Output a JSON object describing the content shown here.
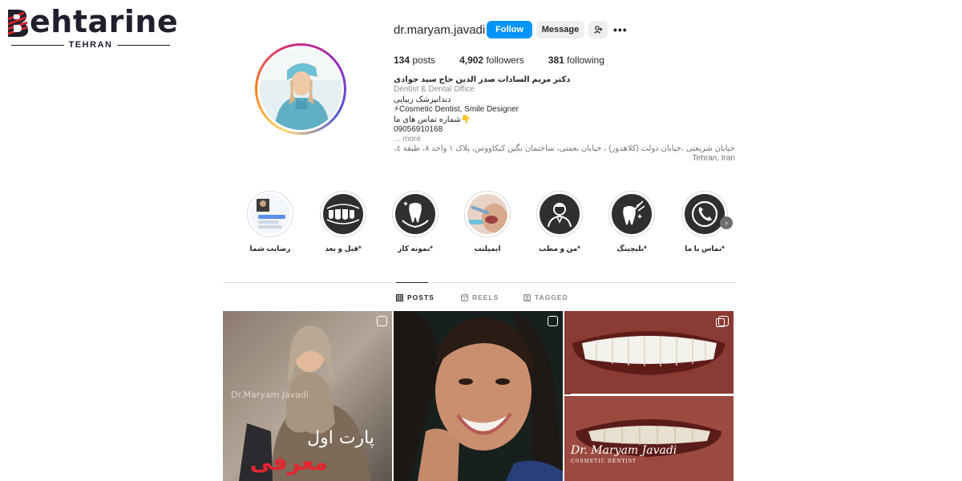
{
  "watermark": {
    "brand": "ehtarine",
    "brand_initial": "B",
    "city": "TEHRAN"
  },
  "profile": {
    "username": "dr.maryam.javadi",
    "follow_label": "Follow",
    "message_label": "Message",
    "add_user_icon": "person-add-icon",
    "more_icon": "more-options-icon",
    "more_glyph": "•••",
    "stats": {
      "posts_count": "134",
      "posts_label": "posts",
      "followers_count": "4,902",
      "followers_label": "followers",
      "following_count": "381",
      "following_label": "following"
    }
  },
  "bio": {
    "name": "دکتر مریم السادات صدر الدین حاج سید جوادی",
    "category": "Dentist & Dental Office",
    "line1": "دندانپزشک زیبایی",
    "line2": "⚡Cosmetic Dentist, Smile Designer",
    "line3": "👇شماره تماس های ما",
    "phone": "09056910168",
    "more": "... more",
    "address": "خیابان شریعتی ،خیابان دولت (کلاهدوز) ، خیابان نعمتی، ساختمان نگین کیکاووس، پلاک ۱ واحد ۸، طبقه ٤،",
    "city": "Tehran, Iran"
  },
  "highlights": [
    {
      "label": "رضایت شما",
      "icon": "chat-screenshot-thumb"
    },
    {
      "label": "*قبل و بعد",
      "icon": "teeth-row-icon"
    },
    {
      "label": "*نمونه کار",
      "icon": "tooth-hands-icon"
    },
    {
      "label": "ایمپلنت",
      "icon": "dental-procedure-photo"
    },
    {
      "label": "*من و مطب",
      "icon": "doctor-icon"
    },
    {
      "label": "*بلیچینگ",
      "icon": "tooth-bleaching-icon"
    },
    {
      "label": "*تماس با ما",
      "icon": "phone-icon"
    }
  ],
  "highlights_next": "›",
  "tabs": [
    {
      "label": "POSTS",
      "icon": "grid-icon",
      "active": true
    },
    {
      "label": "REELS",
      "icon": "reels-icon",
      "active": false
    },
    {
      "label": "TAGGED",
      "icon": "tagged-icon",
      "active": false
    }
  ],
  "posts": [
    {
      "type": "reel",
      "overlay_line1": "پارت اول",
      "overlay_line2": "معرفی",
      "watermark": "Dr.Maryam Javadi"
    },
    {
      "type": "reel"
    },
    {
      "type": "carousel",
      "signature": "Dr. Maryam Javadi",
      "signature_sub": "COSMETIC DENTIST"
    }
  ],
  "colors": {
    "follow_button": "#0095f6",
    "secondary_button": "#efefef",
    "text": "#262626",
    "muted": "#8e8e8e",
    "divider": "#dbdbdb",
    "overlay_red": "#e3262f"
  }
}
